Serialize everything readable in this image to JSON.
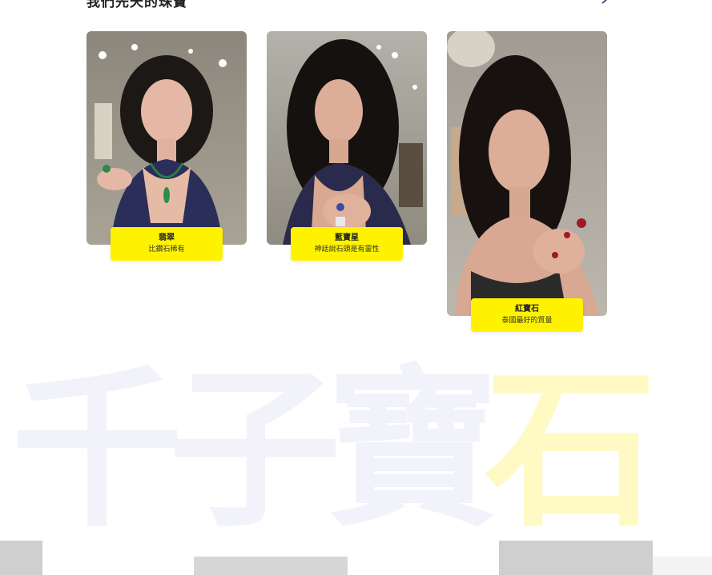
{
  "section": {
    "title": "我們先天的珠寶"
  },
  "nav": {
    "arrow_icon": "arrow-right-icon"
  },
  "cards": [
    {
      "name": "翡翠",
      "desc": "比鑽石稀有"
    },
    {
      "name": "藍寶星",
      "desc": "神話說石頭是有靈性"
    },
    {
      "name": "紅寶石",
      "desc": "泰國最好的質量"
    }
  ],
  "brand": {
    "text_part": "千子寶",
    "text_accent": "石"
  },
  "colors": {
    "label_bg": "#fff200",
    "brand_text": "#f2f2fa",
    "brand_accent": "#fff9c4"
  }
}
